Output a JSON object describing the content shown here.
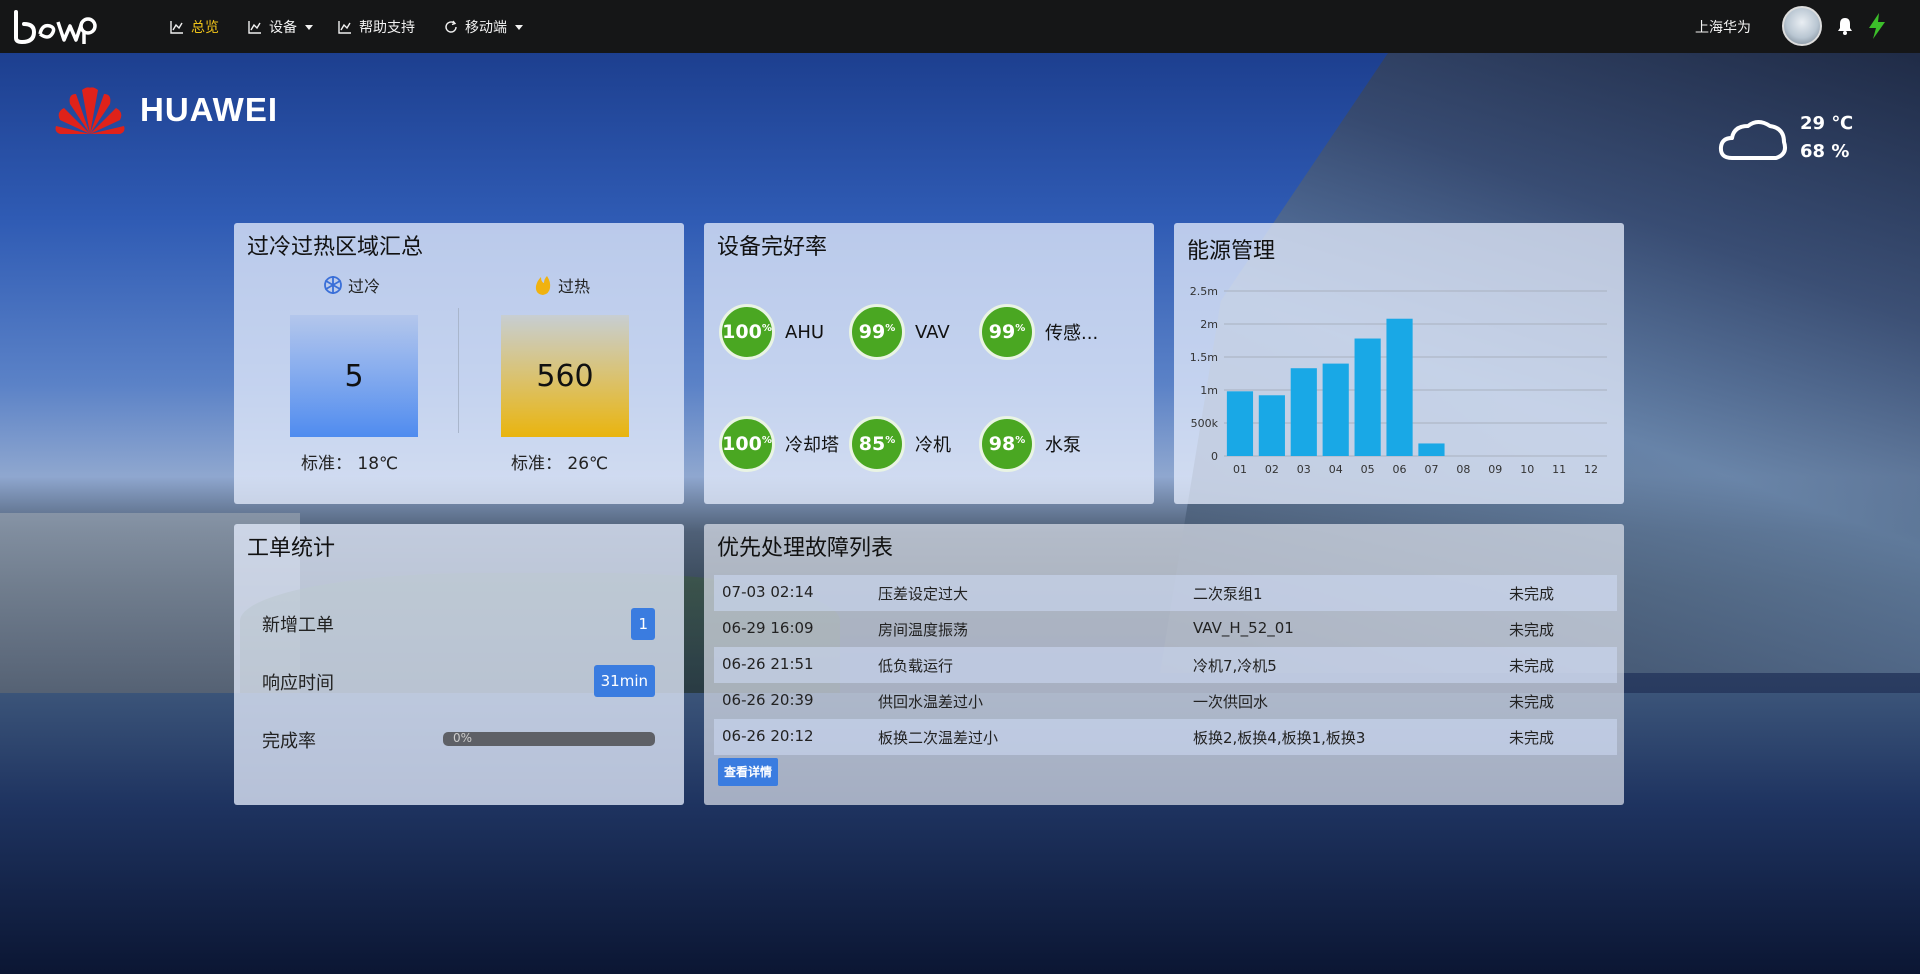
{
  "nav": {
    "items": [
      {
        "label": "总览",
        "icon": "line-chart-icon",
        "active": true
      },
      {
        "label": "设备",
        "icon": "line-chart-icon",
        "dropdown": true
      },
      {
        "label": "帮助支持",
        "icon": "line-chart-icon"
      },
      {
        "label": "移动端",
        "icon": "refresh-icon",
        "dropdown": true
      }
    ],
    "user": "上海华为",
    "icons": [
      "bell-icon",
      "bolt-icon"
    ]
  },
  "brand": {
    "name": "HUAWEI"
  },
  "weather": {
    "temperature": "29 ℃",
    "humidity": "68 %",
    "icon": "cloud-icon"
  },
  "overheat": {
    "title": "过冷过热区域汇总",
    "cool": {
      "label": "过冷",
      "value": "5",
      "standard": "标准： 18℃",
      "icon": "snowflake-icon",
      "color": "#4f8bef"
    },
    "hot": {
      "label": "过热",
      "value": "560",
      "standard": "标准： 26℃",
      "icon": "flame-icon",
      "color": "#e9b40e"
    }
  },
  "equipment": {
    "title": "设备完好率",
    "items": [
      {
        "value": "100",
        "name": "AHU"
      },
      {
        "value": "99",
        "name": "VAV"
      },
      {
        "value": "99",
        "name": "传感..."
      },
      {
        "value": "100",
        "name": "冷却塔"
      },
      {
        "value": "85",
        "name": "冷机"
      },
      {
        "value": "98",
        "name": "水泵"
      }
    ],
    "unit": "%",
    "color": "#4aa722"
  },
  "energy": {
    "title": "能源管理",
    "chart_data": {
      "type": "bar",
      "categories": [
        "01",
        "02",
        "03",
        "04",
        "05",
        "06",
        "07",
        "08",
        "09",
        "10",
        "11",
        "12"
      ],
      "values": [
        980000,
        920000,
        1330000,
        1400000,
        1780000,
        2080000,
        190000,
        0,
        0,
        0,
        0,
        0
      ],
      "ylim": [
        0,
        2500000
      ],
      "yticks": [
        "0",
        "500k",
        "1m",
        "1.5m",
        "2m",
        "2.5m"
      ],
      "grid": true,
      "color": "#19a8e6"
    }
  },
  "workorder": {
    "title": "工单统计",
    "new_label": "新增工单",
    "new_value": "1",
    "response_label": "响应时间",
    "response_value": "31min",
    "completion_label": "完成率",
    "completion_value": "0%",
    "completion_fraction": 0
  },
  "faults": {
    "title": "优先处理故障列表",
    "rows": [
      {
        "time": "07-03 02:14",
        "desc": "压差设定过大",
        "device": "二次泵组1",
        "status": "未完成"
      },
      {
        "time": "06-29 16:09",
        "desc": "房间温度振荡",
        "device": "VAV_H_52_01",
        "status": "未完成"
      },
      {
        "time": "06-26 21:51",
        "desc": "低负载运行",
        "device": "冷机7,冷机5",
        "status": "未完成"
      },
      {
        "time": "06-26 20:39",
        "desc": "供回水温差过小",
        "device": "一次供回水",
        "status": "未完成"
      },
      {
        "time": "06-26 20:12",
        "desc": "板换二次温差过小",
        "device": "板换2,板换4,板换1,板换3",
        "status": "未完成"
      }
    ],
    "detail_button": "查看详情"
  }
}
